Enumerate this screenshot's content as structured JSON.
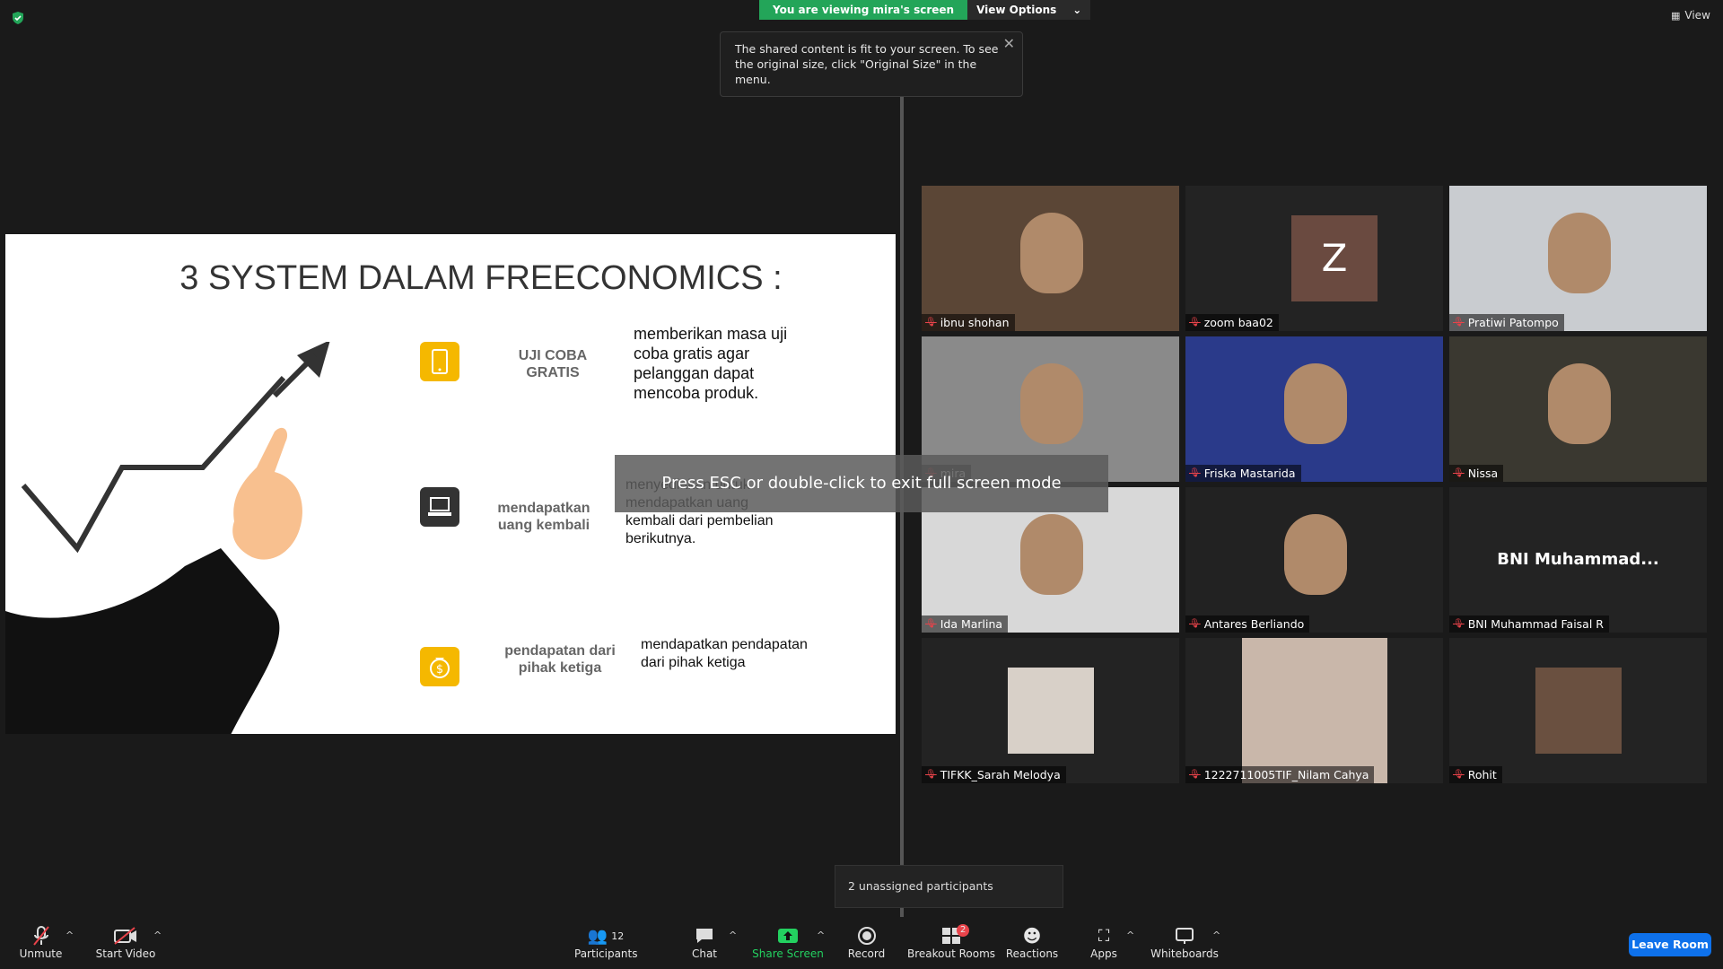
{
  "banner": {
    "viewing_text": "You are viewing mira's screen",
    "view_options": "View Options"
  },
  "tooltip": {
    "text": "The shared content is fit to your screen. To see the original size, click \"Original Size\" in the menu."
  },
  "top_right": {
    "view_label": "View"
  },
  "slide": {
    "title": "3 SYSTEM DALAM FREECONOMICS :",
    "items": [
      {
        "label": "UJI COBA\nGRATIS",
        "text": "memberikan masa uji coba gratis agar pelanggan dapat mencoba produk.",
        "icon": "phone-icon"
      },
      {
        "label": "mendapatkan uang kembali",
        "text": "menyediakan untuk mendapatkan uang kembali dari pembelian berikutnya.",
        "icon": "laptop-icon"
      },
      {
        "label": "pendapatan dari pihak ketiga",
        "text": "mendapatkan pendapatan dari pihak ketiga",
        "icon": "money-bag-icon"
      }
    ]
  },
  "esc_overlay": "Press ESC or double-click to exit full screen mode",
  "participants_tiles": [
    {
      "name": "ibnu shohan",
      "type": "video"
    },
    {
      "name": "zoom baa02",
      "type": "avatar",
      "avatar_letter": "Z"
    },
    {
      "name": "Pratiwi Patompo",
      "type": "video"
    },
    {
      "name": "mira",
      "type": "video",
      "active": true
    },
    {
      "name": "Friska Mastarida",
      "type": "video"
    },
    {
      "name": "Nissa",
      "type": "video"
    },
    {
      "name": "Ida Marlina",
      "type": "video"
    },
    {
      "name": "Antares Berliando",
      "type": "video"
    },
    {
      "name": "BNI Muhammad Faisal R",
      "type": "name",
      "display": "BNI  Muhammad..."
    },
    {
      "name": "TIFKK_Sarah Melodya",
      "type": "photo"
    },
    {
      "name": "1222711005TIF_Nilam Cahya",
      "type": "photo"
    },
    {
      "name": "Rohit",
      "type": "photo"
    }
  ],
  "unassigned": "2 unassigned participants",
  "toolbar": {
    "unmute": "Unmute",
    "start_video": "Start Video",
    "participants": "Participants",
    "participants_count": "12",
    "chat": "Chat",
    "share_screen": "Share Screen",
    "record": "Record",
    "breakout_rooms": "Breakout Rooms",
    "breakout_badge": "2",
    "reactions": "Reactions",
    "apps": "Apps",
    "whiteboards": "Whiteboards",
    "leave": "Leave Room"
  },
  "colors": {
    "accent_green": "#23a559",
    "leave_blue": "#0e71eb",
    "active_border": "#e8e26b",
    "muted_red": "#e8434a"
  }
}
